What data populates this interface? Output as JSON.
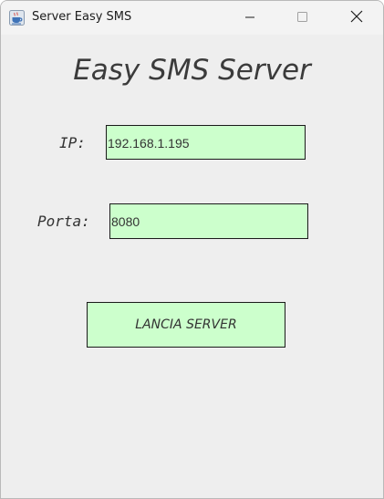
{
  "window": {
    "title": "Server Easy SMS",
    "app_icon": "java-cup-icon",
    "controls": {
      "minimize_icon": "minimize-icon",
      "maximize_icon": "maximize-icon",
      "close_icon": "close-icon"
    }
  },
  "main": {
    "heading": "Easy SMS Server",
    "ip_label": "IP:",
    "ip_value": "192.168.1.195",
    "port_label": "Porta:",
    "port_value": "8080",
    "launch_button_label": "LANCIA SERVER"
  },
  "colors": {
    "field_background": "#ccffcc",
    "window_background": "#eeeeee",
    "text": "#333333"
  }
}
